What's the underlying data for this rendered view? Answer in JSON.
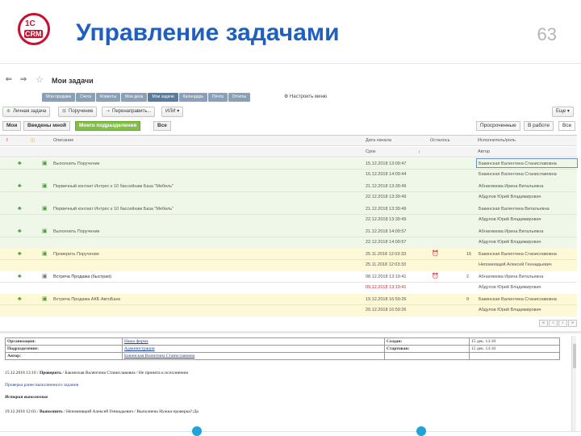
{
  "slide": {
    "title": "Управление задачами",
    "page_number": "63",
    "logo_top": "1С",
    "logo_bottom": "CRM"
  },
  "window": {
    "title": "Мои задачи",
    "back_icon": "arrow-left-icon",
    "forward_icon": "arrow-right-icon"
  },
  "menu": {
    "items": [
      "Мои продажи",
      "Счета",
      "Клиенты",
      "Мои дела",
      "Мои задачи",
      "Календарь",
      "Почта",
      "Отчеты"
    ],
    "active_index": 4,
    "setup": "Настроить меню"
  },
  "toolbar": {
    "personal_task": "Личная задача",
    "assignment": "Поручение",
    "redirect": "Перенаправить...",
    "or": "ИЛИ",
    "more": "Еще"
  },
  "filters": {
    "tabs": [
      "Мои",
      "Введены мной",
      "Моего подразделения",
      "Все"
    ],
    "selected_index": 2,
    "right_tabs": [
      "Просроченные",
      "В работе",
      "Все"
    ]
  },
  "grid": {
    "headers": {
      "description": "Описание",
      "date_start": "Дата начала",
      "deadline": "Срок",
      "remaining": "Осталось",
      "executor": "Исполнитель/роль",
      "author": "Автор",
      "sort_indicator": "↓"
    },
    "rows": [
      {
        "description": "Выполнить  Поручение",
        "date_start": "15.12.2018 13:09:47",
        "deadline": "16.12.2018 14:09:44",
        "remaining": "",
        "executor": "Бакинская Валентина Станиславовна",
        "author": "Бакинская Валентина Станиславовна",
        "style": "green",
        "clock": false,
        "deadline_red": false
      },
      {
        "description": "Первичный контакт  Интрес к 10 бассейнам  База \"Мебель\"",
        "date_start": "21.12.2018 13:39:49",
        "deadline": "22.12.2018 13:39:49",
        "remaining": "",
        "executor": "Абнагимова Ирина Витальевна",
        "author": "Абдулов Юрий Владимирович",
        "style": "green",
        "clock": false,
        "deadline_red": false
      },
      {
        "description": "Первичный контакт  Интрес к 10 бассейнам  База \"Мебель\"",
        "date_start": "21.12.2018 13:39:49",
        "deadline": "22.12.2018 13:39:49",
        "remaining": "",
        "executor": "Бакинская Валентина Витальевна",
        "author": "Абдулов Юрий Владимирович",
        "style": "green",
        "clock": false,
        "deadline_red": false
      },
      {
        "description": "Выполнить  Поручение",
        "date_start": "21.12.2018 14:09:57",
        "deadline": "22.12.2018 14:09:57",
        "remaining": "",
        "executor": "Абнагимова Ирина Витальевна",
        "author": "Абдулов Юрий Владимирович",
        "style": "green",
        "clock": false,
        "deadline_red": false
      },
      {
        "description": "Проверить  Поручение",
        "date_start": "25.11.2018 12:03:33",
        "deadline": "25.11.2018 12:03:33",
        "remaining": "16",
        "executor": "Бакинская Валентина Станиславовна",
        "author": "Непомнящий Алексей Геннадьевич",
        "style": "yellow",
        "clock": true,
        "deadline_red": false
      },
      {
        "description": "Встреча  Продажа (быстрая)",
        "date_start": "08.12.2018 13:19:41",
        "deadline": "09.12.2018 13:19:41",
        "remaining": "2",
        "executor": "Абнагимова Ирина Витальевна",
        "author": "Абдулов Юрий Владимирович",
        "style": "white",
        "clock": true,
        "deadline_red": true
      },
      {
        "description": "Встреча  Продажа  АКБ АвтоБанк",
        "date_start": "19.12.2018 16:59:26",
        "deadline": "20.12.2018 16:59:26",
        "remaining": "9",
        "executor": "Бакинская Валентина Станиславовна",
        "author": "Абдулов Юрий Владимирович",
        "style": "yellow",
        "clock": false,
        "deadline_red": false
      }
    ],
    "nav": [
      "«",
      "‹",
      "›",
      "»"
    ]
  },
  "details": {
    "info": [
      {
        "k": "Организация:",
        "v": "Наша фирма",
        "k2": "Создан:",
        "v2": "15 дек. 13:10"
      },
      {
        "k": "Подразделение:",
        "v": "Администрация",
        "k2": "Стартован:",
        "v2": "15 дек. 13:10"
      },
      {
        "k": "Автор:",
        "v": "Бакинская Валентина Станиславовна",
        "k2": "",
        "v2": ""
      }
    ],
    "line1_prefix": "15.12.2018 13:10 / ",
    "line1_action": "Проверить",
    "line1_rest": " / Бакинская Валентина Станиславовна / Не принята к исполнению",
    "link": "Проверка ранее выполненного задания",
    "history_title": "История выполнения",
    "line2_prefix": "19.12.2018 12:03 / ",
    "line2_action": "Выполнить",
    "line2_rest": " / Непомнящий Алексей Геннадьевич / Выполнена Нужна проверка?:Да"
  }
}
